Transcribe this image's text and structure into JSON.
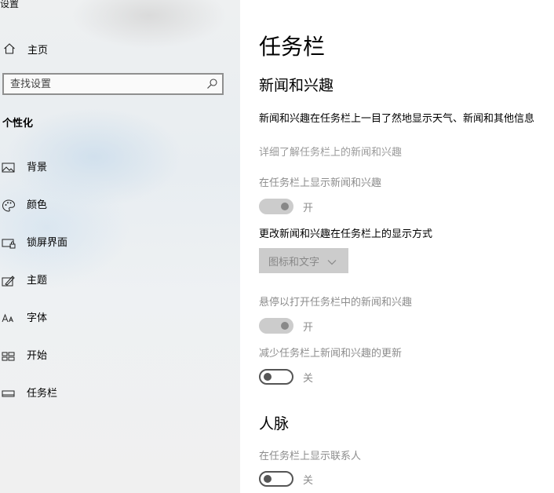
{
  "app": {
    "title": "设置"
  },
  "sidebar": {
    "home_label": "主页",
    "search_placeholder": "查找设置",
    "section_title": "个性化",
    "items": [
      {
        "label": "背景",
        "icon": "picture-icon"
      },
      {
        "label": "颜色",
        "icon": "palette-icon"
      },
      {
        "label": "锁屏界面",
        "icon": "lock-screen-icon"
      },
      {
        "label": "主题",
        "icon": "theme-icon"
      },
      {
        "label": "字体",
        "icon": "font-icon"
      },
      {
        "label": "开始",
        "icon": "start-icon"
      },
      {
        "label": "任务栏",
        "icon": "taskbar-icon"
      }
    ]
  },
  "main": {
    "title": "任务栏",
    "news": {
      "heading": "新闻和兴趣",
      "description": "新闻和兴趣在任务栏上一目了然地显示天气、新闻和其他信息",
      "learn_more_link": "详细了解任务栏上的新闻和兴趣",
      "show_label": "在任务栏上显示新闻和兴趣",
      "show_toggle_state": "开",
      "mode_label": "更改新闻和兴趣在任务栏上的显示方式",
      "mode_value": "图标和文字",
      "hover_label": "悬停以打开任务栏中的新闻和兴趣",
      "hover_toggle_state": "开",
      "reduce_label": "减少任务栏上新闻和兴趣的更新",
      "reduce_toggle_state": "关"
    },
    "people": {
      "heading": "人脉",
      "show_label": "在任务栏上显示联系人",
      "toggle_state": "关"
    }
  },
  "colors": {
    "accent_disabled": "#cccccc",
    "link_gray": "#9a9a9a"
  }
}
